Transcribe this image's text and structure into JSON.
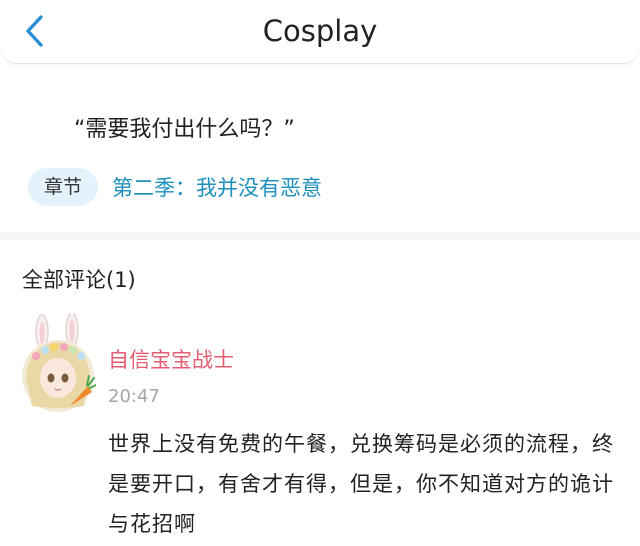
{
  "header": {
    "title": "Cosplay",
    "back_icon": "chevron-left-icon",
    "accent_color": "#2b8fd6"
  },
  "quote": {
    "text": "“需要我付出什么吗？”"
  },
  "chapter": {
    "tag_label": "章节",
    "link_text": "第二季：我并没有恶意"
  },
  "comments": {
    "title": "全部评论(1)",
    "items": [
      {
        "username": "自信宝宝战士",
        "time": "20:47",
        "text": "世界上没有免费的午餐，兑换筹码是必须的流程，终是要开口，有舍才有得，但是，你不知道对方的诡计与花招啊"
      }
    ]
  }
}
